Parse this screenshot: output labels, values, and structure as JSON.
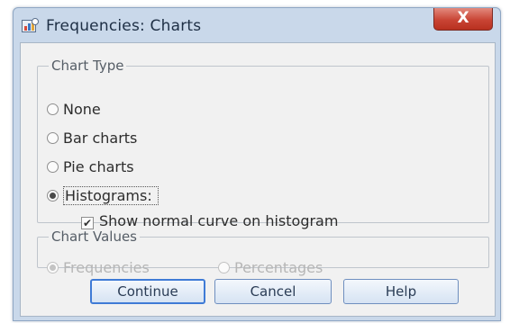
{
  "window": {
    "title": "Frequencies: Charts",
    "close_symbol": "X",
    "icon": "spss-chart-icon"
  },
  "chart_type": {
    "legend": "Chart Type",
    "options": [
      {
        "label": "None",
        "checked": false
      },
      {
        "label": "Bar charts",
        "checked": false
      },
      {
        "label": "Pie charts",
        "checked": false
      },
      {
        "label": "Histograms:",
        "checked": true
      }
    ],
    "normal_curve": {
      "label": "Show normal curve on histogram",
      "checked": true,
      "mark": "✔"
    }
  },
  "chart_values": {
    "legend": "Chart Values",
    "options": [
      {
        "label": "Frequencies",
        "checked": true,
        "enabled": false
      },
      {
        "label": "Percentages",
        "checked": false,
        "enabled": false
      }
    ]
  },
  "buttons": {
    "continue": "Continue",
    "cancel": "Cancel",
    "help": "Help"
  },
  "colors": {
    "title_bar": "#c9d8ea",
    "close_button": "#c94535",
    "dialog_body": "#f1f1f1",
    "button_accent": "#3f7bd6"
  }
}
